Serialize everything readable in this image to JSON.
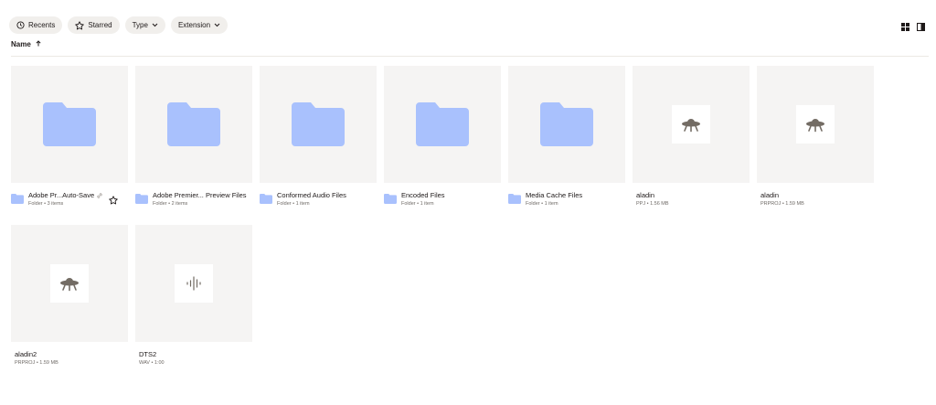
{
  "filters": [
    {
      "label": "Recents",
      "icon": "clock-icon"
    },
    {
      "label": "Starred",
      "icon": "star-icon"
    },
    {
      "label": "Type",
      "icon": "chevron-down-icon"
    },
    {
      "label": "Extension",
      "icon": "chevron-down-icon"
    }
  ],
  "sort": {
    "label": "Name",
    "direction_icon": "arrow-up-icon"
  },
  "view_icons": [
    "grid-view-icon",
    "side-panel-icon"
  ],
  "colors": {
    "folder": "#a9c1fd",
    "thumb_bg": "#f5f4f3",
    "chip_bg": "#f1efec",
    "icon_gray": "#736c64"
  },
  "files": [
    {
      "name": "Adobe Pr...Auto-Save",
      "sub": "Folder • 3 items",
      "kind": "folder",
      "shared_link": true,
      "star": true
    },
    {
      "name": "Adobe Premier... Preview Files",
      "sub": "Folder • 2 items",
      "kind": "folder"
    },
    {
      "name": "Conformed Audio Files",
      "sub": "Folder • 1 item",
      "kind": "folder"
    },
    {
      "name": "Encoded Files",
      "sub": "Folder • 1 item",
      "kind": "folder"
    },
    {
      "name": "Media Cache Files",
      "sub": "Folder • 1 item",
      "kind": "folder"
    },
    {
      "name": "aladin",
      "sub": "PPJ • 1.56 MB",
      "kind": "project",
      "icon": "ufo-icon"
    },
    {
      "name": "aladin",
      "sub": "PRPROJ • 1.59 MB",
      "kind": "project",
      "icon": "ufo-icon"
    },
    {
      "name": "aladin2",
      "sub": "PRPROJ • 1.59 MB",
      "kind": "project",
      "icon": "ufo-icon"
    },
    {
      "name": "DTS2",
      "sub": "WAV • 1:00",
      "kind": "audio",
      "icon": "audio-waveform-icon"
    }
  ]
}
